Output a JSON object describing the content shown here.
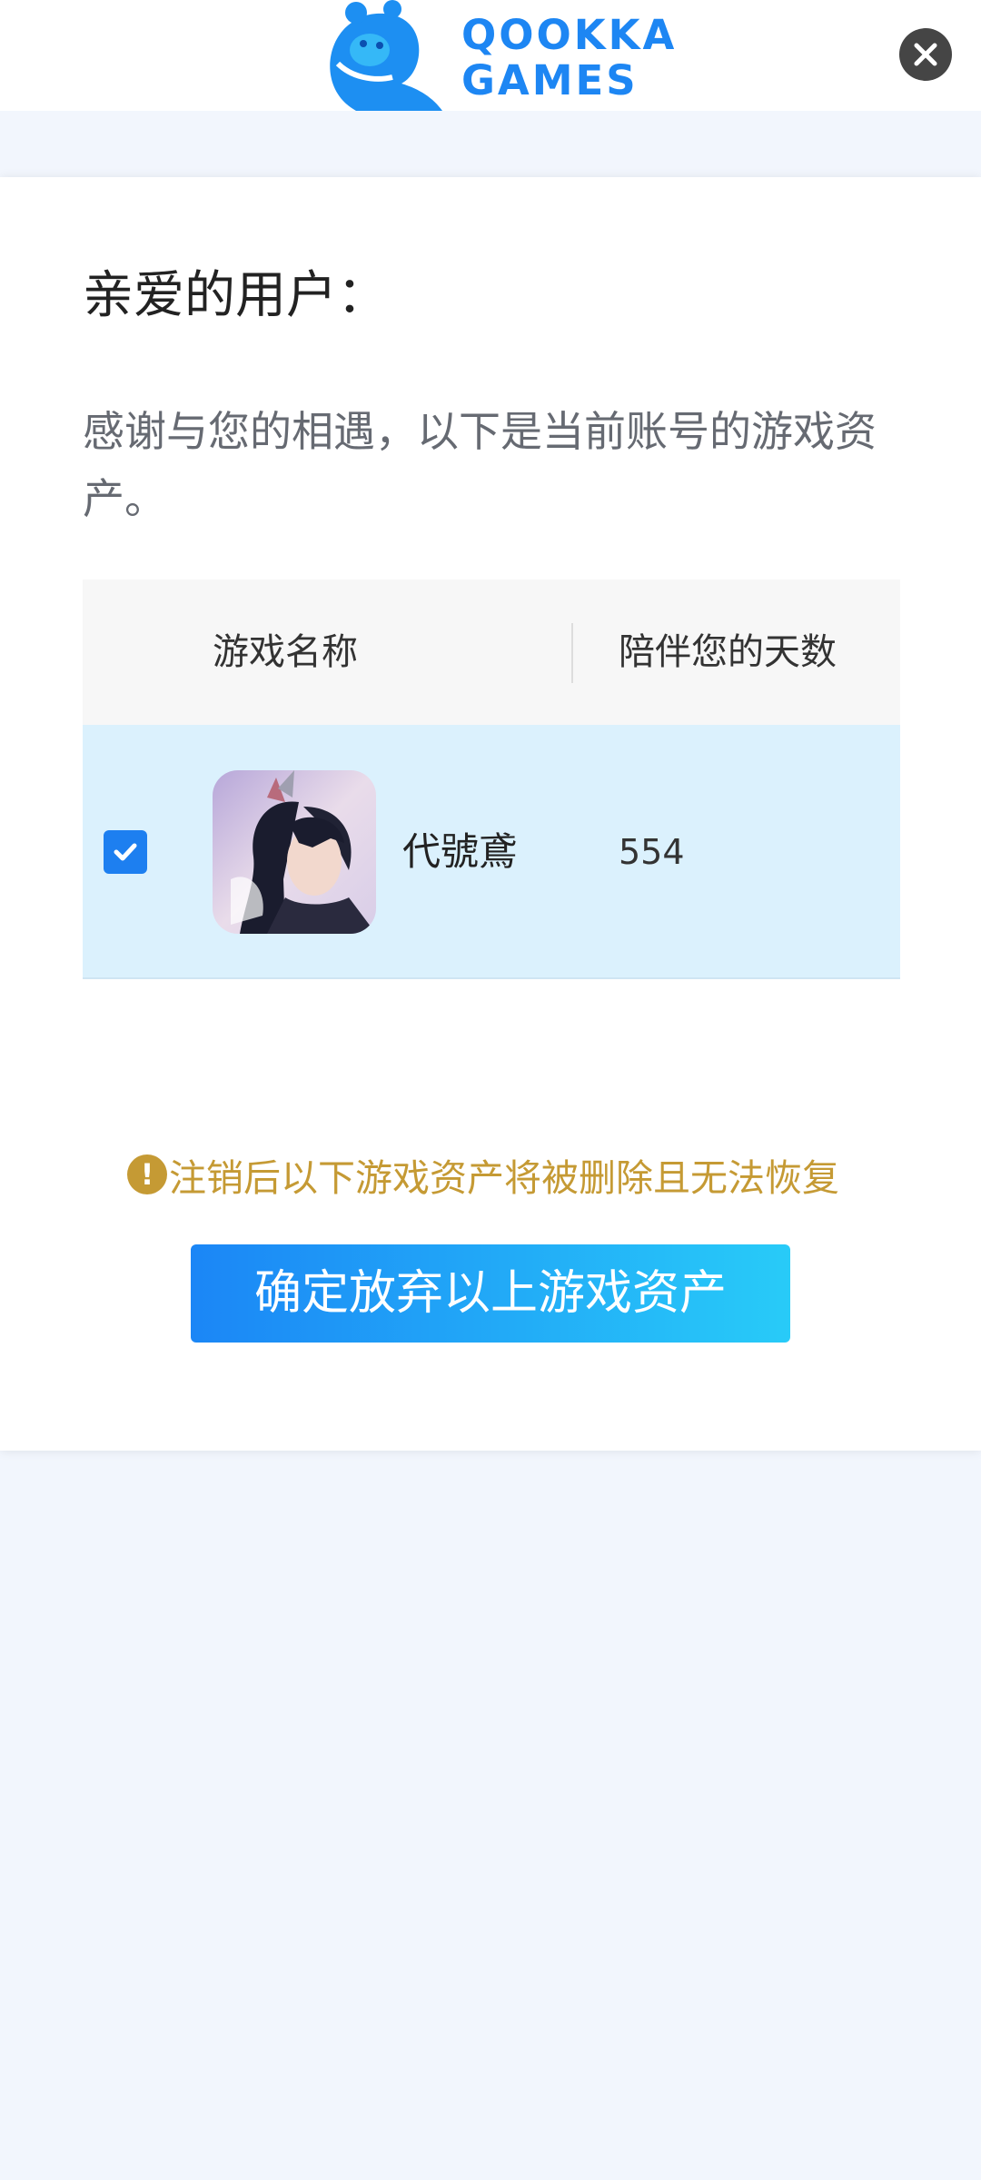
{
  "header": {
    "logo_line1": "QOOKKA",
    "logo_line2": "GAMES",
    "brand_color": "#1d86f3",
    "close_icon": "close-icon"
  },
  "card": {
    "greeting": "亲爱的用户：",
    "intro": "感谢与您的相遇，以下是当前账号的游戏资产。"
  },
  "table": {
    "headers": [
      "游戏名称",
      "陪伴您的天数"
    ],
    "rows": [
      {
        "checked": true,
        "icon": "game-character-icon",
        "name": "代號鳶",
        "days": "554"
      }
    ]
  },
  "warning": {
    "icon": "exclamation-circle-icon",
    "text": "注销后以下游戏资产将被删除且无法恢复",
    "color": "#c59a34"
  },
  "confirm_button": {
    "label": "确定放弃以上游戏资产"
  }
}
